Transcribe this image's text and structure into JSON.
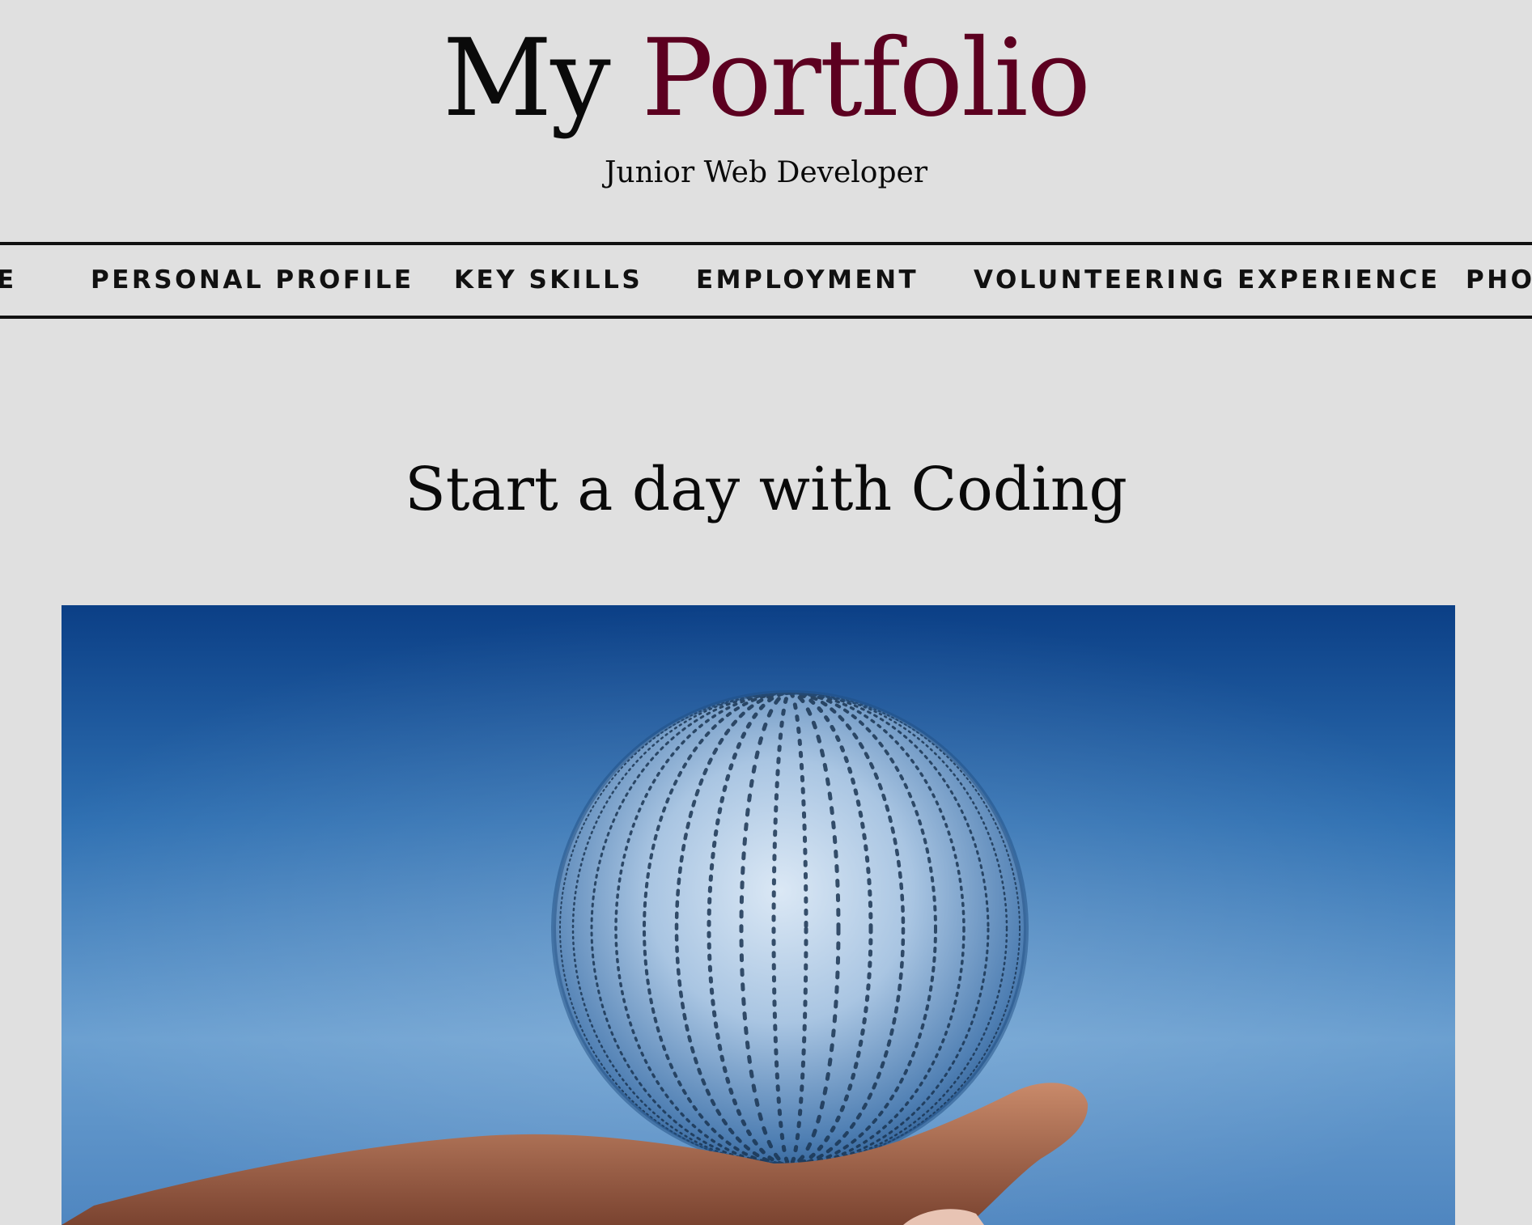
{
  "header": {
    "title_part1": "My",
    "title_part2": "Portfolio",
    "subtitle": "Junior Web Developer"
  },
  "nav": {
    "items": [
      {
        "label": "E"
      },
      {
        "label": "PERSONAL PROFILE"
      },
      {
        "label": "KEY SKILLS"
      },
      {
        "label": "EMPLOYMENT"
      },
      {
        "label": "VOLUNTEERING EXPERIENCE"
      },
      {
        "label": "PHOT"
      }
    ]
  },
  "main": {
    "section_title": "Start a day with Coding",
    "hero_image": {
      "icon": "binary-globe-on-hand-image"
    }
  },
  "colors": {
    "background": "#e0e0e0",
    "title_accent": "#5c0020",
    "hero_blue": "#1e5fa3"
  }
}
